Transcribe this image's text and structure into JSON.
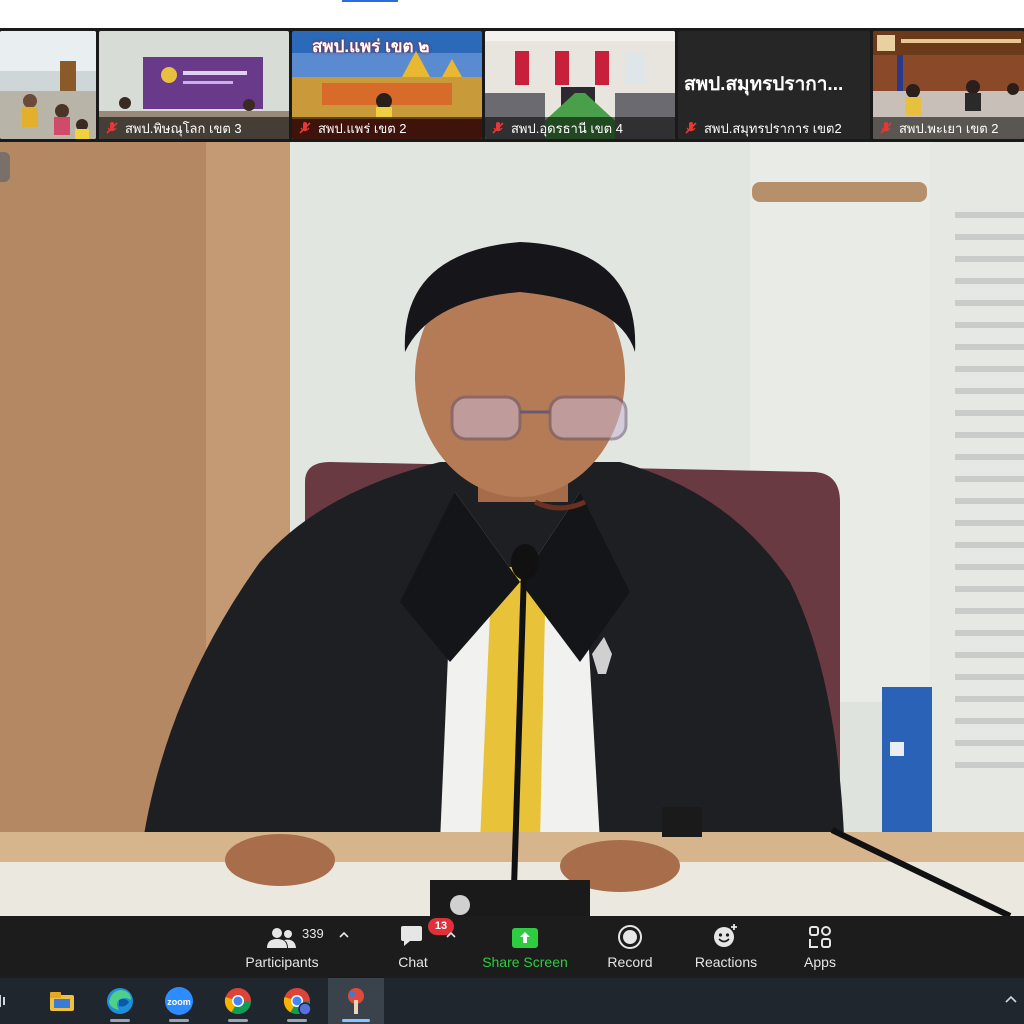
{
  "thumbnails": [
    {
      "label": "",
      "muted": false
    },
    {
      "label": "สพป.พิษณุโลก เขต 3",
      "muted": true
    },
    {
      "label": "สพป.แพร่ เขต 2",
      "muted": true,
      "banner": "สพป.แพร่ เขต ๒"
    },
    {
      "label": "สพป.อุดรธานี เขต 4",
      "muted": true
    },
    {
      "label": "สพป.สมุทรปราการ เขต2",
      "muted": true,
      "display_name": "สพป.สมุทรปรากา..."
    },
    {
      "label": "สพป.พะเยา เขต 2",
      "muted": true
    }
  ],
  "controls": {
    "participants": {
      "label": "Participants",
      "count": "339"
    },
    "chat": {
      "label": "Chat",
      "badge": "13"
    },
    "share": {
      "label": "Share Screen"
    },
    "record": {
      "label": "Record"
    },
    "reactions": {
      "label": "Reactions"
    },
    "apps": {
      "label": "Apps"
    }
  },
  "taskbar": {
    "icons": [
      "file-explorer-icon",
      "edge-icon",
      "zoom-icon",
      "chrome-icon",
      "chrome-profile-icon",
      "paint-app-icon"
    ],
    "zoom_text": "zoom"
  },
  "colors": {
    "control_bar": "#1c1c1c",
    "share_green": "#2ecc40",
    "badge_red": "#e0303a",
    "taskbar": "#20262e"
  }
}
